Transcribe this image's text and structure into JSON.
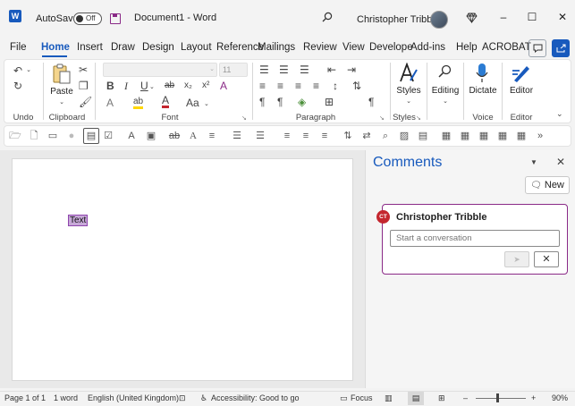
{
  "titlebar": {
    "app_logo": "W",
    "autosave_label": "AutoSave",
    "autosave_state": "Off",
    "document_title": "Document1 - Word",
    "user_name": "Christopher Tribble",
    "icons": [
      "search-icon",
      "diamond-icon",
      "minimize-icon",
      "maximize-icon",
      "close-icon"
    ]
  },
  "menu": {
    "tabs": [
      "File",
      "Home",
      "Insert",
      "Draw",
      "Design",
      "Layout",
      "Reference",
      "Mailings",
      "Review",
      "View",
      "Develope",
      "Add-ins",
      "Help",
      "ACROBAT"
    ],
    "active_tab": "Home"
  },
  "ribbon": {
    "groups": {
      "undo": "Undo",
      "clipboard": "Clipboard",
      "font": "Font",
      "paragraph": "Paragraph",
      "styles": "Styles",
      "voice": "Voice",
      "editor": "Editor"
    },
    "buttons": {
      "paste": "Paste",
      "styles": "Styles",
      "editing": "Editing",
      "dictate": "Dictate",
      "editor": "Editor"
    },
    "font_size": "11",
    "glyphs": {
      "bold": "B",
      "italic": "I",
      "underline": "U",
      "strike": "ab",
      "subscript": "x₂",
      "superscript": "x²",
      "text_effects": "A",
      "highlight": "ab",
      "font_color": "A",
      "change_case": "Aa",
      "clear_format": "A",
      "pilcrow": "¶"
    }
  },
  "document": {
    "selected_text": "Text"
  },
  "comments": {
    "title": "Comments",
    "new_label": "New",
    "card": {
      "initials": "CT",
      "author": "Christopher Tribble",
      "placeholder": "Start a conversation"
    }
  },
  "statusbar": {
    "page": "Page 1 of 1",
    "words": "1 word",
    "language": "English (United Kingdom)",
    "accessibility": "Accessibility: Good to go",
    "focus": "Focus",
    "zoom": "90%"
  },
  "colors": {
    "word_blue": "#185abd",
    "comment_purple": "#8a2a87",
    "badge_red": "#c4262e",
    "selection": "#c7a8d8"
  }
}
